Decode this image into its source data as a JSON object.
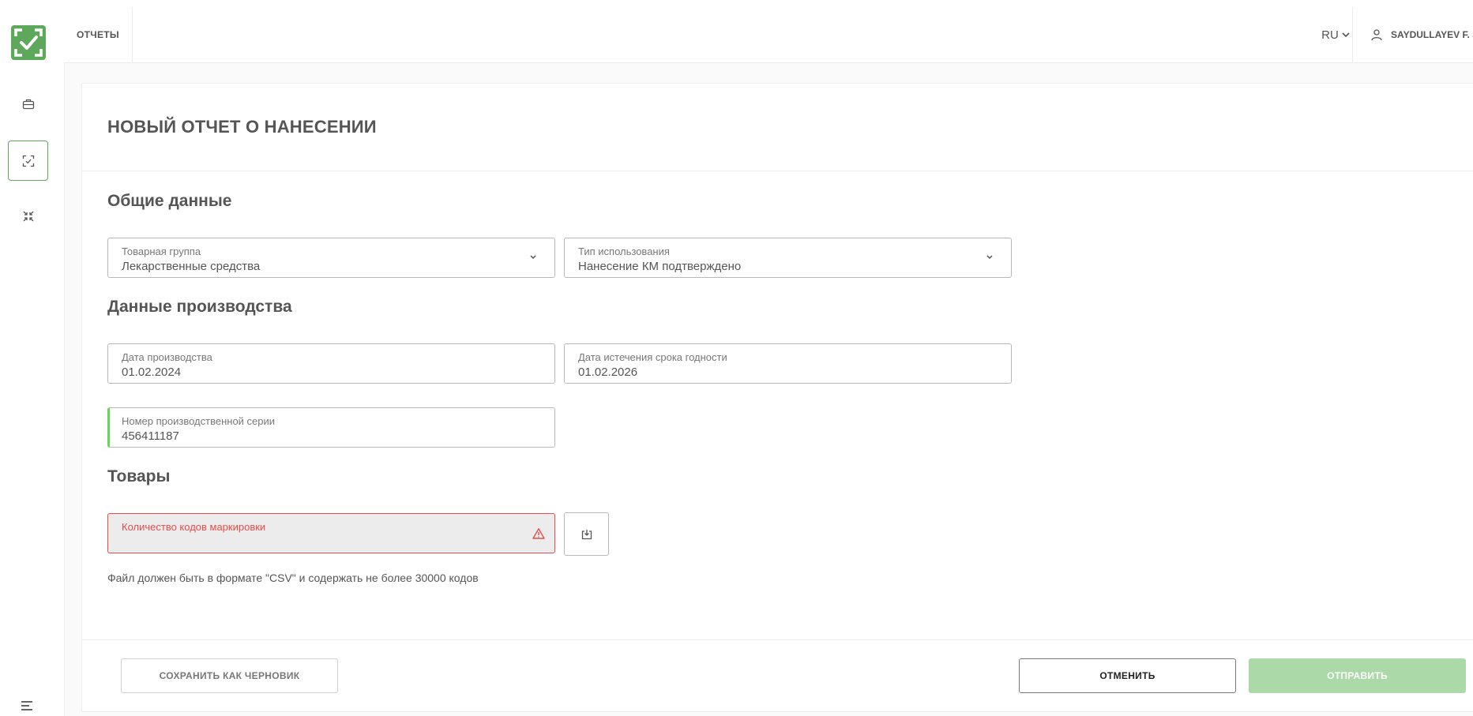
{
  "header": {
    "tab_label": "ОТЧЕТЫ",
    "language": "RU",
    "user_name": "SAYDULLAYEV F. S"
  },
  "sidebar": {
    "items": [
      {
        "icon": "briefcase-icon"
      },
      {
        "icon": "scan-check-icon",
        "active": true
      },
      {
        "icon": "aggregation-icon"
      }
    ],
    "menu_icon": "menu-icon"
  },
  "page": {
    "title": "НОВЫЙ ОТЧЕТ О НАНЕСЕНИИ"
  },
  "general": {
    "title": "Общие данные",
    "product_group": {
      "label": "Товарная группа",
      "value": "Лекарственные средства"
    },
    "usage_type": {
      "label": "Тип использования",
      "value": "Нанесение КМ подтверждено"
    }
  },
  "production": {
    "title": "Данные производства",
    "production_date": {
      "label": "Дата производства",
      "value": "01.02.2024"
    },
    "expiry_date": {
      "label": "Дата истечения срока годности",
      "value": "01.02.2026"
    },
    "batch_number": {
      "label": "Номер производственной серии",
      "value": "456411187"
    }
  },
  "goods": {
    "title": "Товары",
    "codes_count": {
      "label": "Количество кодов маркировки",
      "value": ""
    },
    "hint": "Файл должен быть в формате \"CSV\" и содержать не более 30000 кодов"
  },
  "footer": {
    "save_draft": "СОХРАНИТЬ КАК ЧЕРНОВИК",
    "cancel": "ОТМЕНИТЬ",
    "send": "ОТПРАВИТЬ"
  },
  "colors": {
    "brand_green": "#5ea85c",
    "focus_green": "#6bd35a",
    "error_red": "#e74c4c",
    "send_disabled": "#abd9a7"
  }
}
